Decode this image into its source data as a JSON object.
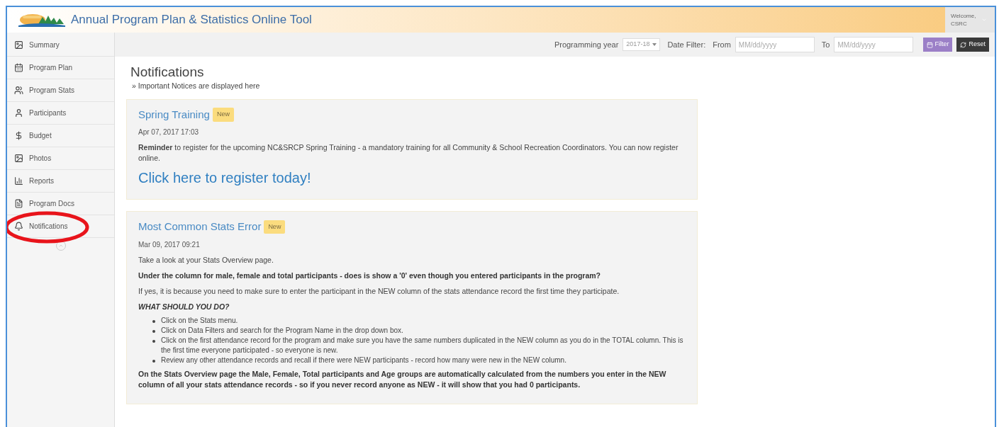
{
  "header": {
    "title": "Annual Program Plan & Statistics Online Tool",
    "user_menu": {
      "label": "Welcome,",
      "name": "CSRC"
    }
  },
  "sidebar": {
    "items": [
      {
        "label": "Summary"
      },
      {
        "label": "Program Plan"
      },
      {
        "label": "Program Stats"
      },
      {
        "label": "Participants"
      },
      {
        "label": "Budget"
      },
      {
        "label": "Photos"
      },
      {
        "label": "Reports"
      },
      {
        "label": "Program Docs"
      },
      {
        "label": "Notifications",
        "circled": true
      }
    ]
  },
  "toolbar": {
    "year_label": "Programming year",
    "year_value": "2017-18",
    "date_filter_label": "Date Filter:",
    "from_label": "From",
    "from_placeholder": "MM/dd/yyyy",
    "to_label": "To",
    "to_placeholder": "MM/dd/yyyy",
    "filter_button": "Filter",
    "reset_button": "Reset"
  },
  "page": {
    "title": "Notifications",
    "subtitle": "» Important Notices are displayed here"
  },
  "notifications": [
    {
      "title": "Spring Training",
      "badge": "New",
      "date": "Apr 07, 2017 17:03",
      "body": [
        {
          "kind": "text",
          "text": "**Reminder** to register for the upcoming NC&SRCP Spring Training - a mandatory training for all Community & School Recreation Coordinators.  You can now register online."
        },
        {
          "kind": "link",
          "text": "Click here to register today!"
        }
      ]
    },
    {
      "title": "Most Common Stats Error",
      "badge": "New",
      "date": "Mar 09, 2017 09:21",
      "body": [
        {
          "kind": "text",
          "text": "Take a look at your Stats Overview page."
        },
        {
          "kind": "bold",
          "text": "Under the column for male, female and total participants - does is show a '0' even though you entered participants in the program?"
        },
        {
          "kind": "text",
          "text": "If yes, it is because you need to make sure to enter the participant in the NEW column of the stats attendance record the first time they participate."
        },
        {
          "kind": "heading",
          "text": "WHAT SHOULD YOU DO?"
        },
        {
          "kind": "list",
          "items": [
            "Click on the Stats menu.",
            "Click on Data Filters and search for the Program Name in the drop down box.",
            "Click on the first attendance record for the program and make sure you have the same numbers duplicated in the NEW column as you do in the TOTAL column.  This is the first time everyone participated - so everyone is new.",
            "Review any other attendance records and recall if there were NEW participants - record how many were new in the NEW column."
          ]
        },
        {
          "kind": "bold",
          "text": "On the Stats Overview page the Male, Female, Total participants and Age groups are automatically calculated from the numbers you enter in the NEW column of all your stats attendance records - so if you never record anyone as NEW - it will show that you had 0 participants."
        }
      ]
    }
  ]
}
